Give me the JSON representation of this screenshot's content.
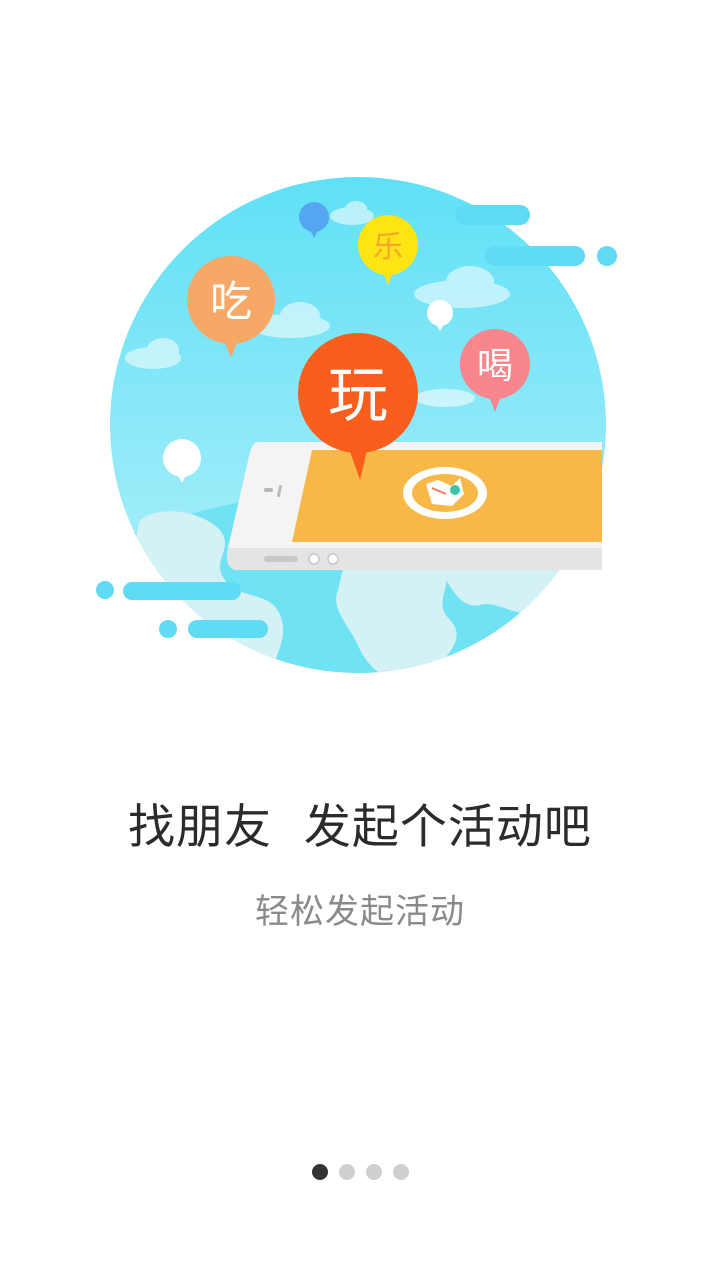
{
  "bubbles": {
    "eat": "吃",
    "joy": "乐",
    "play": "玩",
    "drink": "喝"
  },
  "headline": "找朋友  发起个活动吧",
  "subline": "轻松发起活动",
  "pager": {
    "total": 4,
    "active": 1
  },
  "colors": {
    "sky": "#6de3f5",
    "globe_land": "#d6f2f7",
    "phone_screen": "#f7b847",
    "bubble_eat": "#f8a866",
    "bubble_joy": "#fde413",
    "bubble_play": "#fb5e1c",
    "bubble_drink": "#f8868c",
    "dot_active": "#333333",
    "dot_inactive": "#cfcfcf"
  }
}
